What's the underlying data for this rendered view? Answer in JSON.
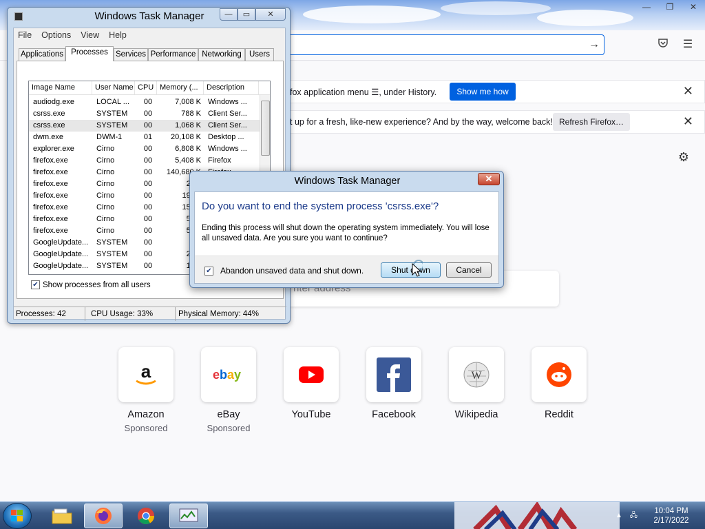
{
  "firefox": {
    "window_controls": [
      "—",
      "❐",
      "✕"
    ],
    "notification1": {
      "text": "fox application menu ☰, under History.",
      "button": "Show me how",
      "close": "✕"
    },
    "notification2": {
      "text": "t up for a fresh, like-new experience? And by the way, welcome back!",
      "button": "Refresh Firefox…",
      "close": "✕"
    },
    "search_placeholder": "nter address",
    "shortcuts": [
      {
        "label": "Amazon",
        "sub": "Sponsored"
      },
      {
        "label": "eBay",
        "sub": "Sponsored"
      },
      {
        "label": "YouTube",
        "sub": ""
      },
      {
        "label": "Facebook",
        "sub": ""
      },
      {
        "label": "Wikipedia",
        "sub": ""
      },
      {
        "label": "Reddit",
        "sub": ""
      }
    ]
  },
  "task_manager": {
    "title": "Windows Task Manager",
    "menu": [
      "File",
      "Options",
      "View",
      "Help"
    ],
    "tabs": [
      "Applications",
      "Processes",
      "Services",
      "Performance",
      "Networking",
      "Users"
    ],
    "active_tab": "Processes",
    "columns": [
      "Image Name",
      "User Name",
      "CPU",
      "Memory (...",
      "Description"
    ],
    "rows": [
      [
        "audiodg.exe",
        "LOCAL ...",
        "00",
        "7,008 K",
        "Windows ..."
      ],
      [
        "csrss.exe",
        "SYSTEM",
        "00",
        "788 K",
        "Client Ser..."
      ],
      [
        "csrss.exe",
        "SYSTEM",
        "00",
        "1,068 K",
        "Client Ser..."
      ],
      [
        "dwm.exe",
        "DWM-1",
        "01",
        "20,108 K",
        "Desktop ..."
      ],
      [
        "explorer.exe",
        "Cirno",
        "00",
        "6,808 K",
        "Windows ..."
      ],
      [
        "firefox.exe",
        "Cirno",
        "00",
        "5,408 K",
        "Firefox"
      ],
      [
        "firefox.exe",
        "Cirno",
        "00",
        "140,680 K",
        "Firefox"
      ],
      [
        "firefox.exe",
        "Cirno",
        "00",
        "2,01",
        ""
      ],
      [
        "firefox.exe",
        "Cirno",
        "00",
        "19,83",
        ""
      ],
      [
        "firefox.exe",
        "Cirno",
        "00",
        "15,88",
        ""
      ],
      [
        "firefox.exe",
        "Cirno",
        "00",
        "5,33",
        ""
      ],
      [
        "firefox.exe",
        "Cirno",
        "00",
        "5,34",
        ""
      ],
      [
        "GoogleUpdate...",
        "SYSTEM",
        "00",
        "63",
        ""
      ],
      [
        "GoogleUpdate...",
        "SYSTEM",
        "00",
        "2,35",
        ""
      ],
      [
        "GoogleUpdate...",
        "SYSTEM",
        "00",
        "1,28",
        ""
      ]
    ],
    "selected_row": 2,
    "show_all": "Show processes from all users",
    "status": {
      "processes": "Processes: 42",
      "cpu": "CPU Usage: 33%",
      "memory": "Physical Memory: 44%"
    }
  },
  "dialog": {
    "title": "Windows Task Manager",
    "close": "✕",
    "main": "Do you want to end the system process 'csrss.exe'?",
    "detail": "Ending this process will shut down the operating system immediately.  You will lose all unsaved data.  Are you sure you want to continue?",
    "checkbox": "Abandon unsaved data and shut down.",
    "checkbox_checked": true,
    "shutdown_button": "Shut down",
    "cancel_button": "Cancel"
  },
  "taskbar": {
    "time": "10:04 PM",
    "date": "2/17/2022"
  }
}
